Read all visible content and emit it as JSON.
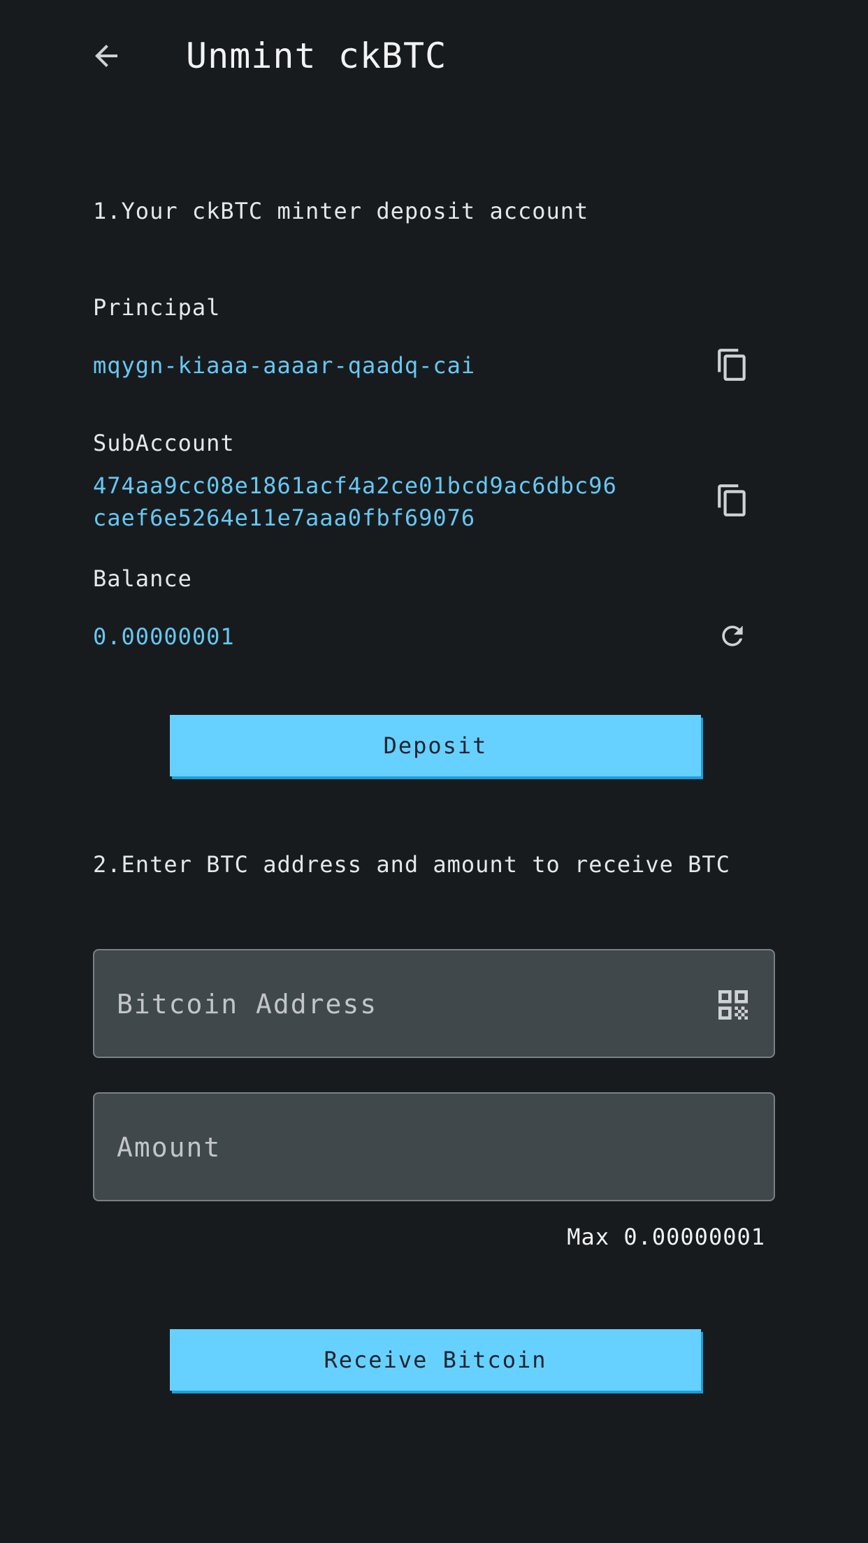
{
  "header": {
    "title": "Unmint ckBTC",
    "back_icon": "arrow-left-icon"
  },
  "deposit_section": {
    "title": "1.Your ckBTC minter deposit account",
    "principal": {
      "label": "Principal",
      "value": "mqygn-kiaaa-aaaar-qaadq-cai",
      "icon": "copy-icon"
    },
    "subaccount": {
      "label": "SubAccount",
      "value_line1": "474aa9cc08e1861acf4a2ce01bcd9ac6dbc96",
      "value_line2": "caef6e5264e11e7aaa0fbf69076",
      "icon": "copy-icon"
    },
    "balance": {
      "label": "Balance",
      "value": "0.00000001",
      "icon": "refresh-icon"
    },
    "deposit_button": "Deposit"
  },
  "receive_section": {
    "title": "2.Enter BTC address and amount to receive BTC",
    "address_input": {
      "placeholder": "Bitcoin Address",
      "value": "",
      "icon": "qr-code-icon"
    },
    "amount_input": {
      "placeholder": "Amount",
      "value": ""
    },
    "max_label": "Max 0.00000001",
    "receive_button": "Receive Bitcoin"
  },
  "colors": {
    "background": "#181b1e",
    "accent": "#66d1ff",
    "value_text": "#66c8f2",
    "input_bg": "#41484c"
  }
}
